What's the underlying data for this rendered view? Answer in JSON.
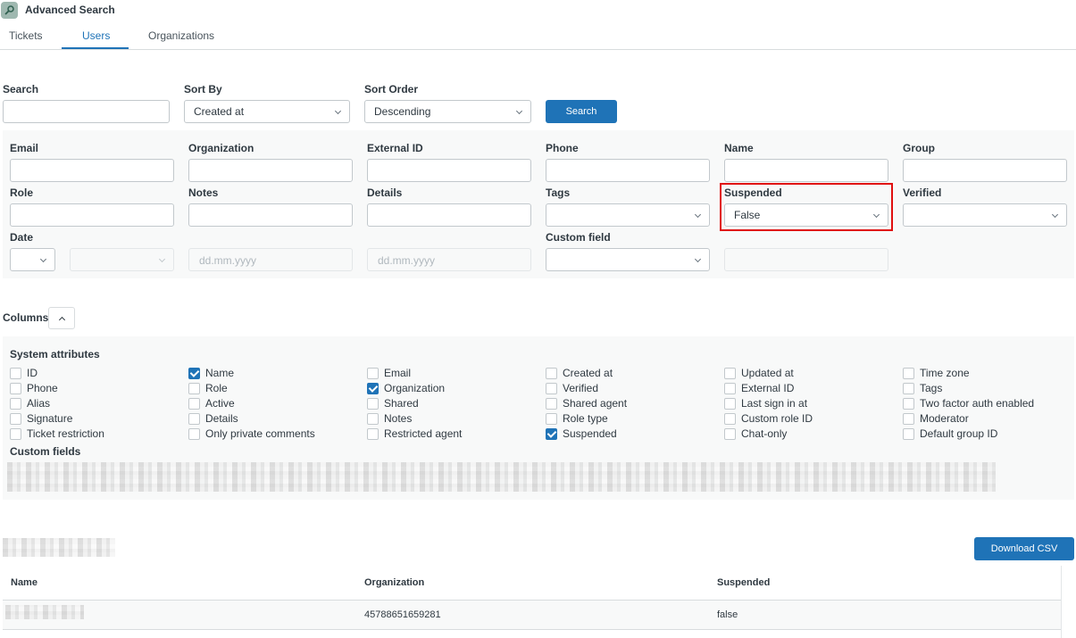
{
  "app": {
    "title": "Advanced Search",
    "icon": "search-app-icon"
  },
  "tabs": [
    {
      "label": "Tickets",
      "active": false
    },
    {
      "label": "Users",
      "active": true
    },
    {
      "label": "Organizations",
      "active": false
    }
  ],
  "search": {
    "search_label": "Search",
    "search_value": "",
    "sort_by_label": "Sort By",
    "sort_by_value": "Created at",
    "sort_order_label": "Sort Order",
    "sort_order_value": "Descending",
    "button_label": "Search"
  },
  "filters": {
    "email": "Email",
    "organization": "Organization",
    "external_id": "External ID",
    "phone": "Phone",
    "name": "Name",
    "group": "Group",
    "role": "Role",
    "notes": "Notes",
    "details": "Details",
    "tags": "Tags",
    "suspended": "Suspended",
    "suspended_value": "False",
    "verified": "Verified",
    "date": "Date",
    "date_from_placeholder": "dd.mm.yyyy",
    "date_to_placeholder": "dd.mm.yyyy",
    "custom_field": "Custom field"
  },
  "columns": {
    "label": "Columns",
    "system_attributes_label": "System attributes",
    "custom_fields_label": "Custom fields",
    "items": [
      {
        "label": "ID",
        "checked": false
      },
      {
        "label": "Phone",
        "checked": false
      },
      {
        "label": "Alias",
        "checked": false
      },
      {
        "label": "Signature",
        "checked": false
      },
      {
        "label": "Ticket restriction",
        "checked": false
      },
      {
        "label": "Name",
        "checked": true
      },
      {
        "label": "Role",
        "checked": false
      },
      {
        "label": "Active",
        "checked": false
      },
      {
        "label": "Details",
        "checked": false
      },
      {
        "label": "Only private comments",
        "checked": false
      },
      {
        "label": "Email",
        "checked": false
      },
      {
        "label": "Organization",
        "checked": true
      },
      {
        "label": "Shared",
        "checked": false
      },
      {
        "label": "Notes",
        "checked": false
      },
      {
        "label": "Restricted agent",
        "checked": false
      },
      {
        "label": "Created at",
        "checked": false
      },
      {
        "label": "Verified",
        "checked": false
      },
      {
        "label": "Shared agent",
        "checked": false
      },
      {
        "label": "Role type",
        "checked": false
      },
      {
        "label": "Suspended",
        "checked": true
      },
      {
        "label": "Updated at",
        "checked": false
      },
      {
        "label": "External ID",
        "checked": false
      },
      {
        "label": "Last sign in at",
        "checked": false
      },
      {
        "label": "Custom role ID",
        "checked": false
      },
      {
        "label": "Chat-only",
        "checked": false
      },
      {
        "label": "Time zone",
        "checked": false
      },
      {
        "label": "Tags",
        "checked": false
      },
      {
        "label": "Two factor auth enabled",
        "checked": false
      },
      {
        "label": "Moderator",
        "checked": false
      },
      {
        "label": "Default group ID",
        "checked": false
      }
    ]
  },
  "results": {
    "download_label": "Download CSV",
    "headers": [
      "Name",
      "Organization",
      "Suspended"
    ],
    "rows": [
      {
        "name": "",
        "organization": "45788651659281",
        "suspended": "false"
      }
    ]
  }
}
